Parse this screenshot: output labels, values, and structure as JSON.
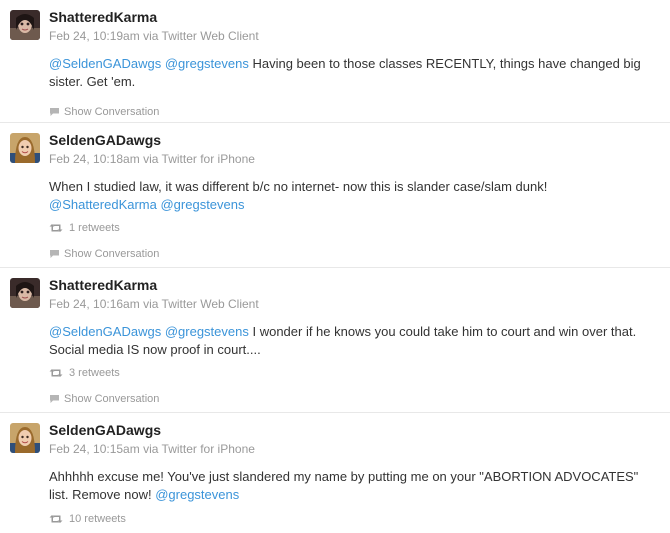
{
  "tweets": [
    {
      "username": "ShatteredKarma",
      "timestamp": "Feb 24, 10:19am",
      "via": "via Twitter Web Client",
      "mention1": "@SeldenGADawgs",
      "mention2": "@gregstevens",
      "body": " Having been to those classes RECENTLY, things have changed big sister. Get 'em.",
      "conversation": "Show Conversation"
    },
    {
      "username": "SeldenGADawgs",
      "timestamp": "Feb 24, 10:18am",
      "via": "via Twitter for iPhone",
      "body": "When I studied law, it was different b/c no internet- now this is slander case/slam dunk! ",
      "mention1": "@ShatteredKarma",
      "mention2": "@gregstevens",
      "retweets": "1 retweets",
      "conversation": "Show Conversation"
    },
    {
      "username": "ShatteredKarma",
      "timestamp": "Feb 24, 10:16am",
      "via": "via Twitter Web Client",
      "mention1": "@SeldenGADawgs",
      "mention2": "@gregstevens",
      "body": " I wonder if he knows you could take him to court and win over that. Social media IS now proof in court....",
      "retweets": "3 retweets",
      "conversation": "Show Conversation"
    },
    {
      "username": "SeldenGADawgs",
      "timestamp": "Feb 24, 10:15am",
      "via": "via Twitter for iPhone",
      "body": "Ahhhhh excuse me! You've just slandered my name by putting me on your \"ABORTION ADVOCATES\" list. Remove now! ",
      "mention1": "@gregstevens",
      "retweets": "10 retweets"
    }
  ],
  "colors": {
    "link": "#3b94d9",
    "meta": "#999999",
    "text": "#333333",
    "divider": "#e8e8e8"
  },
  "icons": {
    "retweet": "retweet-icon",
    "conversation": "speech-bubble-icon",
    "avatar_shattered": "avatar-shatteredkarma",
    "avatar_selden": "avatar-seldengadawgs"
  }
}
